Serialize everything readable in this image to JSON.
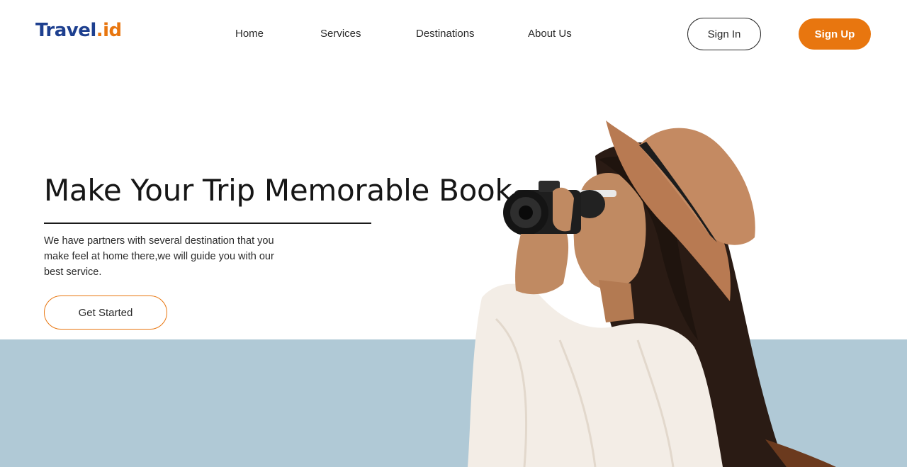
{
  "header": {
    "logo_main": "Travel",
    "logo_suffix": ".id",
    "nav": [
      "Home",
      "Services",
      "Destinations",
      "About Us"
    ],
    "sign_in": "Sign In",
    "sign_up": "Sign Up"
  },
  "hero": {
    "headline": "Make Your Trip Memorable Book",
    "description": "We have partners with several destination that you make feel at home there,we will guide you with our best service.",
    "cta": "Get Started"
  },
  "colors": {
    "brand_blue": "#1d3f8f",
    "accent_orange": "#e8760f",
    "band_blue": "#b0c9d6"
  }
}
